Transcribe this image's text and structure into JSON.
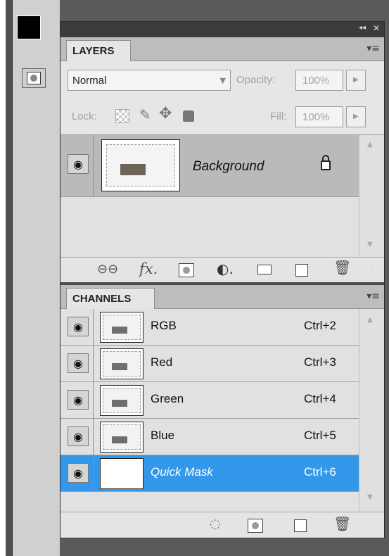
{
  "layers_panel": {
    "tab_label": "LAYERS",
    "blend_mode": "Normal",
    "opacity_label": "Opacity:",
    "opacity_value": "100%",
    "lock_label": "Lock:",
    "fill_label": "Fill:",
    "fill_value": "100%",
    "layers": [
      {
        "name": "Background",
        "locked": true
      }
    ],
    "footer_icons": [
      "link-icon",
      "fx-icon",
      "mask-icon",
      "adjustment-icon",
      "folder-icon",
      "new-layer-icon",
      "trash-icon"
    ]
  },
  "channels_panel": {
    "tab_label": "CHANNELS",
    "channels": [
      {
        "name": "RGB",
        "shortcut": "Ctrl+2"
      },
      {
        "name": "Red",
        "shortcut": "Ctrl+3"
      },
      {
        "name": "Green",
        "shortcut": "Ctrl+4"
      },
      {
        "name": "Blue",
        "shortcut": "Ctrl+5"
      },
      {
        "name": "Quick Mask",
        "shortcut": "Ctrl+6",
        "selected": true
      }
    ],
    "footer_icons": [
      "load-selection-icon",
      "save-selection-icon",
      "new-channel-icon",
      "trash-icon"
    ]
  },
  "panel_header": {
    "collapse_glyph": "◂◂",
    "close_glyph": "✕"
  },
  "colors": {
    "selection": "#3398ea",
    "panel_bg": "#e6e6e6",
    "dark_bg": "#5a5a5a"
  }
}
